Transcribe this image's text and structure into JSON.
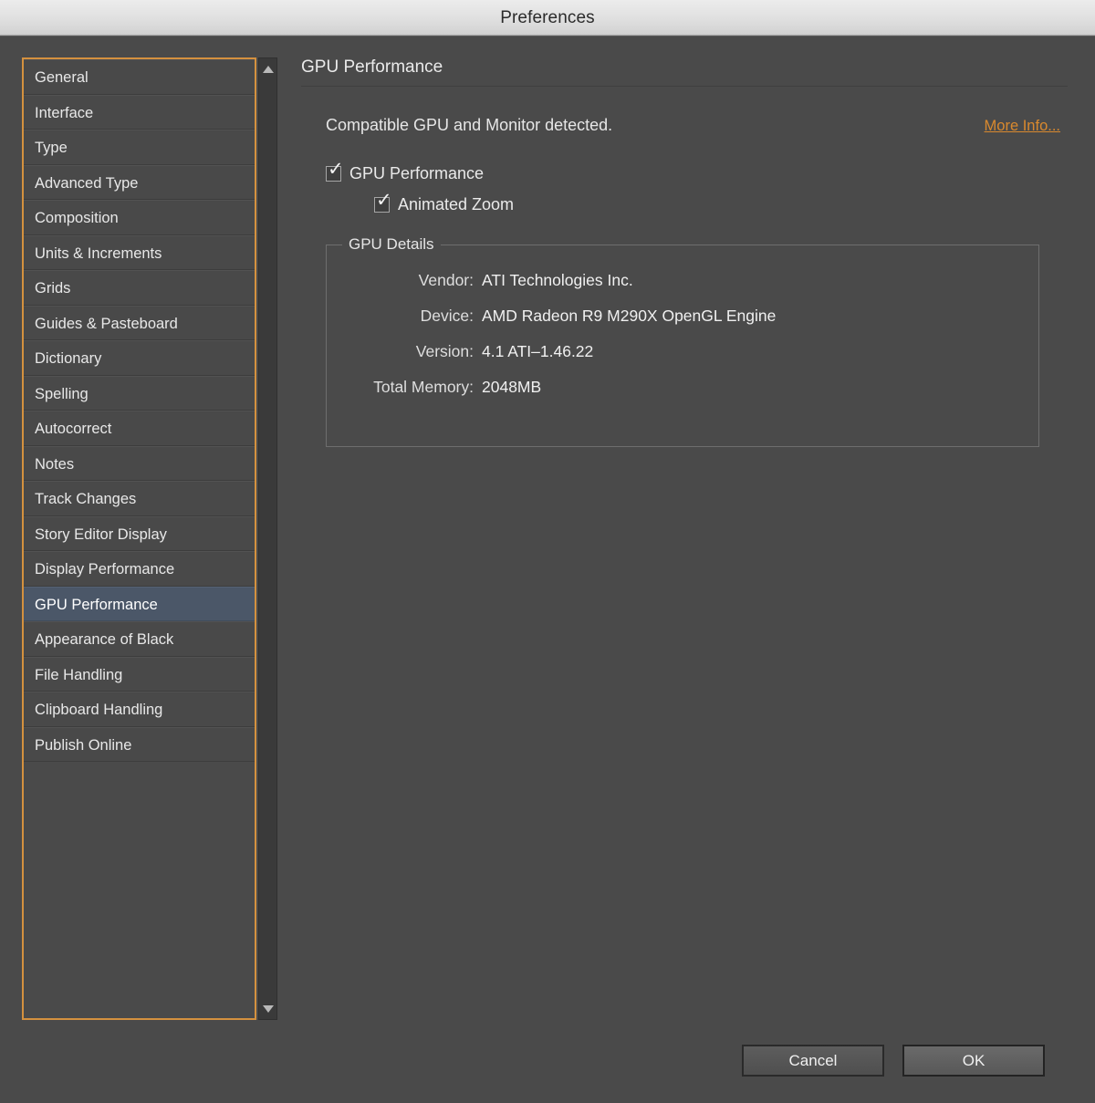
{
  "window": {
    "title": "Preferences"
  },
  "sidebar": {
    "items": [
      {
        "label": "General",
        "selected": false
      },
      {
        "label": "Interface",
        "selected": false
      },
      {
        "label": "Type",
        "selected": false
      },
      {
        "label": "Advanced Type",
        "selected": false
      },
      {
        "label": "Composition",
        "selected": false
      },
      {
        "label": "Units & Increments",
        "selected": false
      },
      {
        "label": "Grids",
        "selected": false
      },
      {
        "label": "Guides & Pasteboard",
        "selected": false
      },
      {
        "label": "Dictionary",
        "selected": false
      },
      {
        "label": "Spelling",
        "selected": false
      },
      {
        "label": "Autocorrect",
        "selected": false
      },
      {
        "label": "Notes",
        "selected": false
      },
      {
        "label": "Track Changes",
        "selected": false
      },
      {
        "label": "Story Editor Display",
        "selected": false
      },
      {
        "label": "Display Performance",
        "selected": false
      },
      {
        "label": "GPU Performance",
        "selected": true
      },
      {
        "label": "Appearance of Black",
        "selected": false
      },
      {
        "label": "File Handling",
        "selected": false
      },
      {
        "label": "Clipboard Handling",
        "selected": false
      },
      {
        "label": "Publish Online",
        "selected": false
      }
    ],
    "scrollbar": {
      "up_arrow_icon": "triangle-up-icon",
      "down_arrow_icon": "triangle-down-icon"
    },
    "focus_border_color": "#d4913f",
    "selected_color": "#4b5768"
  },
  "main": {
    "panel_title": "GPU Performance",
    "status_text": "Compatible GPU and Monitor detected.",
    "more_info_label": "More Info...",
    "more_info_color": "#d9892e",
    "checkboxes": [
      {
        "label": "GPU Performance",
        "checked": true,
        "check_glyph": "✓"
      },
      {
        "label": "Animated Zoom",
        "checked": true,
        "check_glyph": "✓"
      }
    ],
    "details": {
      "legend": "GPU Details",
      "rows": [
        {
          "label": "Vendor:",
          "value": "ATI Technologies Inc."
        },
        {
          "label": "Device:",
          "value": "AMD Radeon R9 M290X OpenGL Engine"
        },
        {
          "label": "Version:",
          "value": "4.1 ATI–1.46.22"
        },
        {
          "label": "Total Memory:",
          "value": "2048MB"
        }
      ]
    }
  },
  "footer": {
    "cancel_label": "Cancel",
    "ok_label": "OK"
  }
}
